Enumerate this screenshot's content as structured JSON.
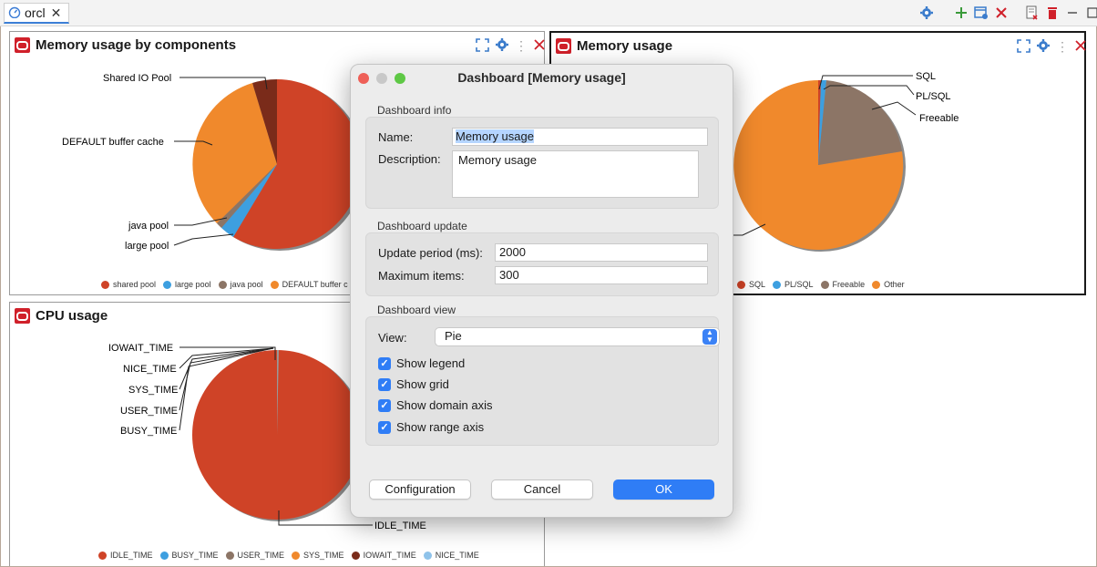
{
  "editor_tab": {
    "label": "orcl"
  },
  "panels": {
    "components": {
      "title": "Memory usage by components",
      "labels": {
        "shared_io": "Shared IO Pool",
        "default_cache": "DEFAULT buffer cache",
        "java": "java pool",
        "large": "large pool"
      },
      "legend": [
        "shared pool",
        "large pool",
        "java pool",
        "DEFAULT buffer c"
      ]
    },
    "memory": {
      "title": "Memory usage",
      "labels": {
        "sql": "SQL",
        "plsql": "PL/SQL",
        "freeable": "Freeable"
      },
      "legend": [
        "SQL",
        "PL/SQL",
        "Freeable",
        "Other"
      ]
    },
    "cpu": {
      "title": "CPU usage",
      "labels": {
        "iowait": "IOWAIT_TIME",
        "nice": "NICE_TIME",
        "sys": "SYS_TIME",
        "user": "USER_TIME",
        "busy": "BUSY_TIME",
        "idle": "IDLE_TIME"
      },
      "legend": [
        "IDLE_TIME",
        "BUSY_TIME",
        "USER_TIME",
        "SYS_TIME",
        "IOWAIT_TIME",
        "NICE_TIME"
      ]
    }
  },
  "colors": {
    "red": "#cf4327",
    "blue": "#3d9fe0",
    "taupe": "#8c7566",
    "orange": "#f0892c",
    "darkred": "#7a2b1a",
    "lightblue": "#8fc3ea"
  },
  "dialog": {
    "title": "Dashboard [Memory usage]",
    "info": {
      "label": "Dashboard info",
      "name_label": "Name:",
      "name_value": "Memory usage",
      "desc_label": "Description:",
      "desc_value": "Memory usage"
    },
    "update": {
      "label": "Dashboard update",
      "period_label": "Update period (ms):",
      "period_value": "2000",
      "max_label": "Maximum items:",
      "max_value": "300"
    },
    "view": {
      "label": "Dashboard view",
      "view_label": "View:",
      "view_value": "Pie",
      "options": [
        "Show legend",
        "Show grid",
        "Show domain axis",
        "Show range axis"
      ]
    },
    "buttons": {
      "configuration": "Configuration",
      "cancel": "Cancel",
      "ok": "OK"
    }
  }
}
